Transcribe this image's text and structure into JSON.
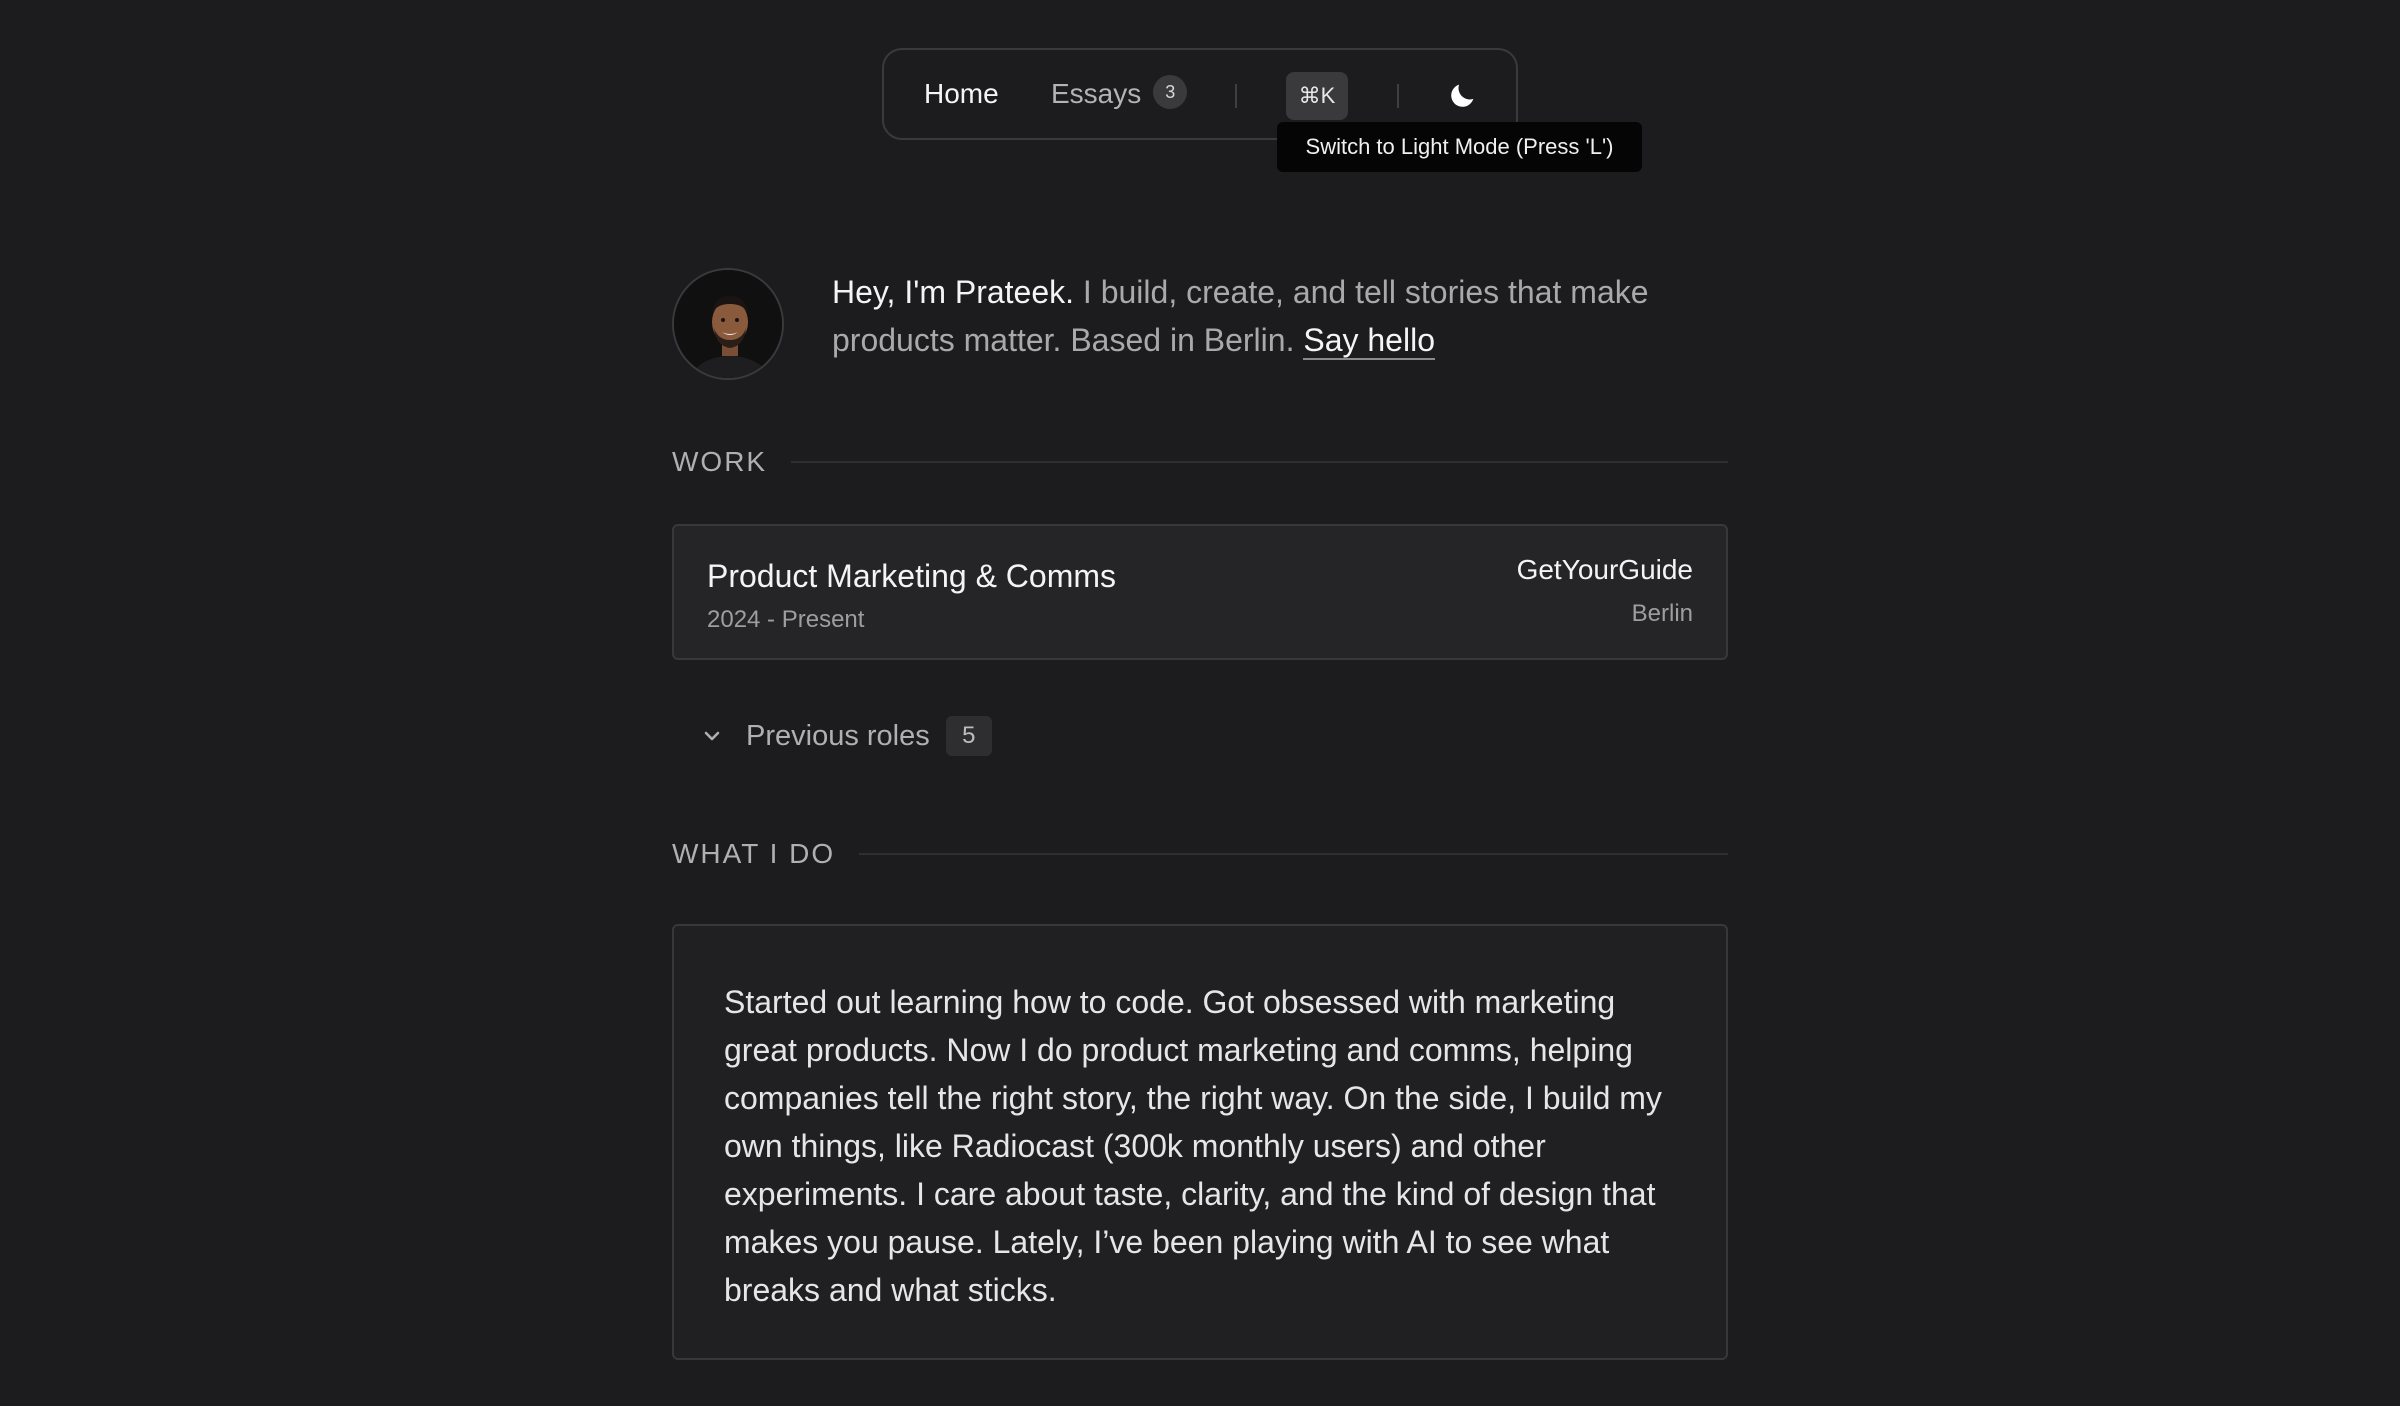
{
  "nav": {
    "home_label": "Home",
    "essays_label": "Essays",
    "essays_count": "3",
    "command_shortcut": "⌘K",
    "theme_icon": "moon-icon",
    "tooltip": "Switch to Light Mode (Press 'L')"
  },
  "intro": {
    "greeting": "Hey, I'm Prateek.",
    "bio": " I build, create, and tell stories that make products matter. Based in Berlin. ",
    "cta": "Say hello"
  },
  "work": {
    "section_title": "WORK",
    "current_role": {
      "title": "Product Marketing & Comms",
      "dates": "2024 - Present",
      "company": "GetYourGuide",
      "location": "Berlin"
    },
    "previous_roles": {
      "label": "Previous roles",
      "count": "5"
    }
  },
  "what_i_do": {
    "section_title": "WHAT I DO",
    "text": "Started out learning how to code. Got obsessed with marketing great products. Now I do product marketing and comms, helping companies tell the right story, the right way. On the side, I build my own things, like Radiocast (300k monthly users) and other experiments. I care about taste, clarity, and the kind of design that makes you pause. Lately, I’ve been playing with AI to see what breaks and what sticks."
  },
  "colors": {
    "background": "#1c1b1d",
    "card": "#252426",
    "text_primary": "#f4f4f4",
    "text_muted": "#a9a8ab",
    "tooltip_bg": "#050505"
  }
}
